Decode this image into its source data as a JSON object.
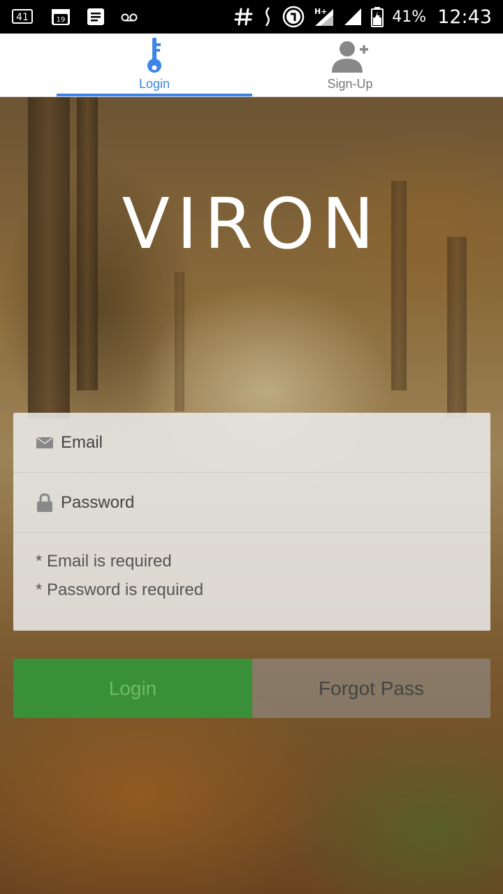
{
  "status_bar": {
    "notification_badge": "41",
    "calendar_day": "19",
    "signal_label": "H+",
    "battery_percent": "41%",
    "time": "12:43"
  },
  "tabs": [
    {
      "label": "Login",
      "icon": "key-icon",
      "active": true
    },
    {
      "label": "Sign-Up",
      "icon": "add-user-icon",
      "active": false
    }
  ],
  "brand": {
    "title": "VIRON"
  },
  "form": {
    "email_placeholder": "Email",
    "password_placeholder": "Password",
    "errors": [
      "* Email is required",
      "* Password is required"
    ]
  },
  "buttons": {
    "login_label": "Login",
    "forgot_label": "Forgot Pass"
  },
  "colors": {
    "accent": "#3d85e6",
    "login_button": "#28a03c",
    "tab_inactive": "#777777"
  }
}
